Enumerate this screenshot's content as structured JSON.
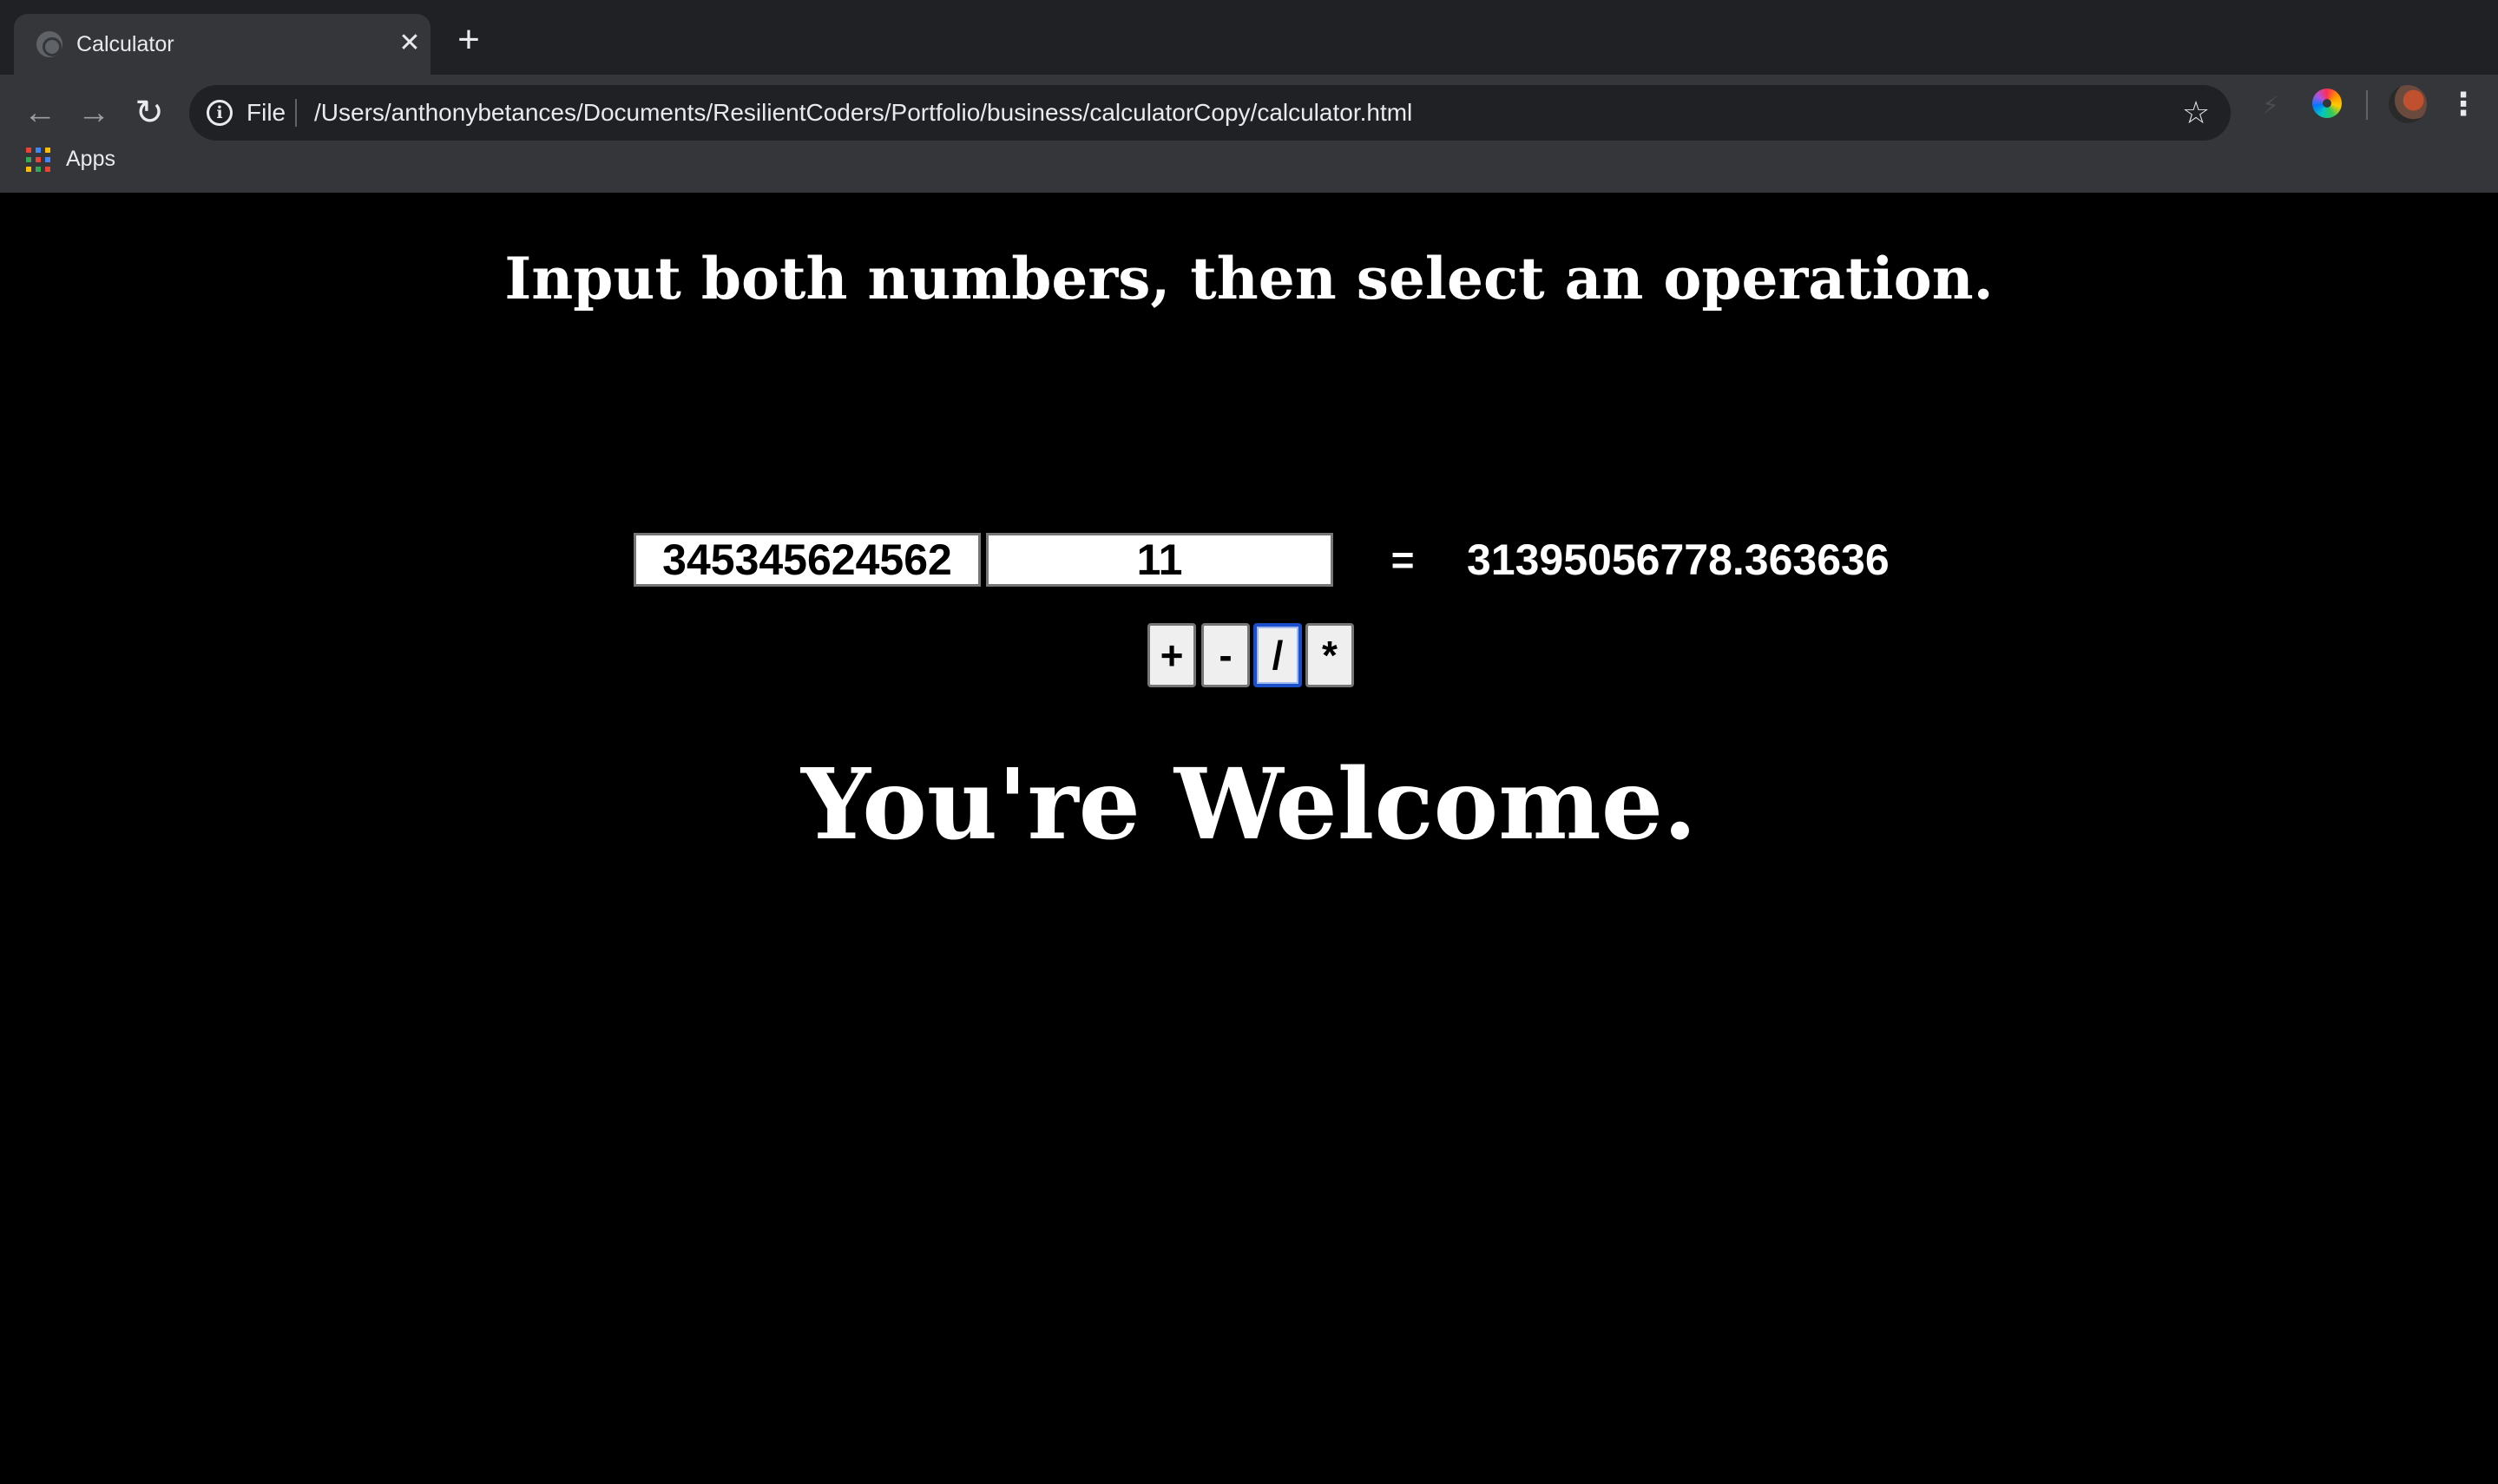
{
  "browser": {
    "tab_title": "Calculator",
    "tab_close": "✕",
    "new_tab": "+",
    "back": "←",
    "forward": "→",
    "reload": "↻",
    "scheme": "File",
    "url": "/Users/anthonybetances/Documents/ResilientCoders/Portfolio/business/calculatorCopy/calculator.html",
    "star": "☆",
    "menu": "⋮",
    "bookmarks": [
      {
        "label": "Apps",
        "icon": "apps-grid-icon"
      }
    ]
  },
  "page": {
    "heading": "Input both numbers, then select an operation.",
    "first_number": "345345624562",
    "second_number": "11",
    "equals": "=",
    "result": "31395056778.363636",
    "operations": [
      "+",
      "-",
      "/",
      "*"
    ],
    "selected_operation": "/",
    "footer": "You're Welcome."
  },
  "colors": {
    "page_background": "#000000",
    "text": "#ffffff",
    "focus_ring": "#1a4fc9"
  }
}
